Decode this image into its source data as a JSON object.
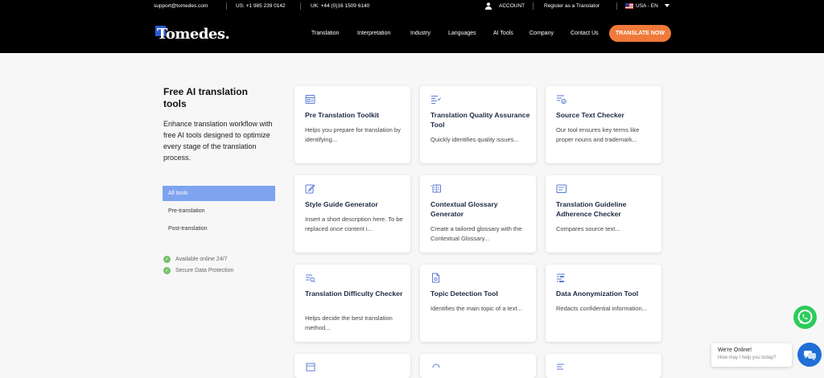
{
  "topbar": {
    "email": "support@tomedes.com",
    "us_phone": "US: +1 985 239 0142",
    "uk_phone": "UK: +44 (0)16 1509 6140",
    "account": "ACCOUNT",
    "register": "Register as a Translator",
    "locale": "USA - EN"
  },
  "nav": {
    "logo": "Tomedes.",
    "items": [
      "Translation",
      "Interpretation",
      "Industry",
      "Languages",
      "AI Tools",
      "Company",
      "Contact Us"
    ],
    "cta": "TRANSLATE NOW"
  },
  "sidebar": {
    "title": "Free AI translation tools",
    "description": "Enhance translation workflow with free AI tools designed to optimize every stage of the translation process.",
    "filters": [
      "All tools",
      "Pre-translation",
      "Post-translation"
    ],
    "features": [
      "Available online 24/7",
      "Secure Data Protection"
    ]
  },
  "cards": [
    {
      "title": "Pre Translation Toolkit",
      "desc": "Helps you prepare for translation by identifying...",
      "icon": "toolkit-icon"
    },
    {
      "title": "Translation Quality Assurance Tool",
      "desc": "Quickly identifies quality issues...",
      "icon": "checklist-icon"
    },
    {
      "title": "Source Text Checker",
      "desc": "Our tool ensures key terms like proper nouns and trademark...",
      "icon": "text-check-icon"
    },
    {
      "title": "Style Guide Generator",
      "desc": "Insert a short description here. To be replaced once content i...",
      "icon": "pen-icon"
    },
    {
      "title": "Contextual Glossary Generator",
      "desc": "Create a tailored glossary with the Contextual Glossary...",
      "icon": "glossary-icon"
    },
    {
      "title": "Translation Guideline Adherence Checker",
      "desc": "Compares source text...",
      "icon": "guideline-icon"
    },
    {
      "title": "Translation Difficulty Checker",
      "desc": "Helps decide the best translation method...",
      "icon": "difficulty-icon"
    },
    {
      "title": "Topic Detection Tool",
      "desc": "Identifies the main topic of a text...",
      "icon": "document-icon"
    },
    {
      "title": "Data Anonymization Tool",
      "desc": "Redacts confidential information...",
      "icon": "anonymize-icon"
    }
  ],
  "chat": {
    "title": "We're Online!",
    "subtitle": "How may I help you today?"
  },
  "colors": {
    "accent": "#f07a3a",
    "active_filter": "#7ea3ef",
    "icon": "#5b7bd6",
    "check": "#76c06a",
    "whatsapp": "#2ccc5a",
    "chat": "#1f6fd6"
  }
}
